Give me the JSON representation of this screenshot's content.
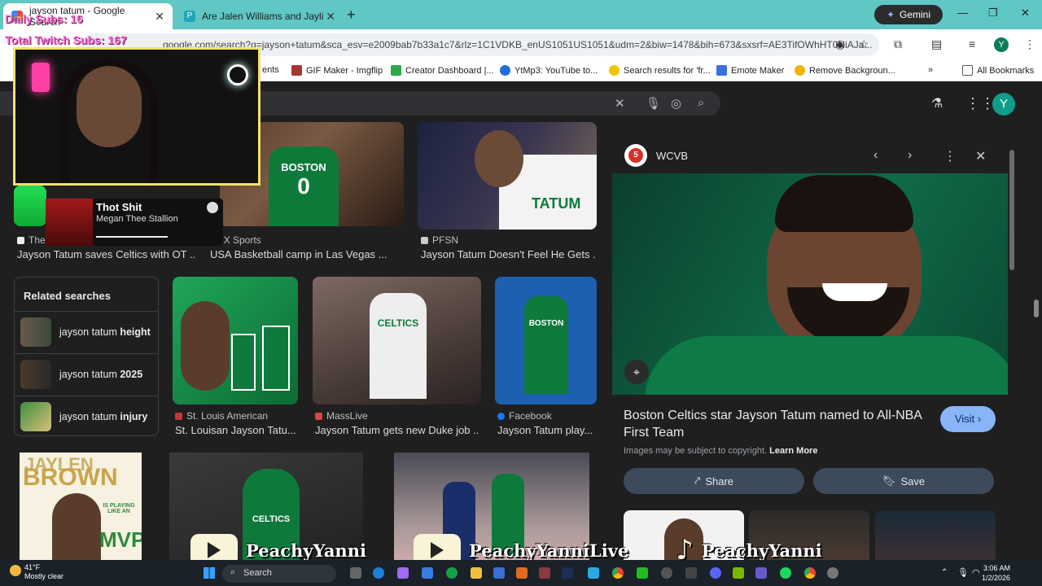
{
  "overlay": {
    "daily_subs": "Daily Subs: 16",
    "total_subs": "Total Twitch Subs: 167",
    "song": "Thot Shit",
    "artist": "Megan Thee Stallion",
    "channels": [
      "PeachyYanni",
      "PeachyYanniLive",
      "PeachyYanni"
    ]
  },
  "tabs": [
    {
      "label": "jayson tatum - Google Search",
      "active": true
    },
    {
      "label": "Are Jalen Williams and Jaylin W",
      "active": false
    }
  ],
  "gemini": "Gemini",
  "address": "google.com/search?q=jayson+tatum&sca_esv=e2009bab7b33a1c7&rlz=1C1VDKB_enUS1051US1051&udm=2&biw=1478&bih=673&sxsrf=AE3TifOWhHT0NiAJa...",
  "bookmarks": [
    "ents",
    "GIF Maker - Imgflip",
    "Creator Dashboard |...",
    "YtMp3: YouTube to...",
    "Search results for 'fr...",
    "Emote Maker",
    "Remove Backgroun...",
    "All Bookmarks"
  ],
  "top_results": [
    {
      "source": "The",
      "caption": "Jayson Tatum saves Celtics with OT ..."
    },
    {
      "source": "FOX Sports",
      "caption": "USA Basketball camp in Las Vegas ..."
    },
    {
      "source": "PFSN",
      "caption": "Jayson Tatum Doesn't Feel He Gets ..."
    }
  ],
  "related": {
    "title": "Related searches",
    "items": [
      {
        "q": "jayson tatum ",
        "b": "height"
      },
      {
        "q": "jayson tatum ",
        "b": "2025"
      },
      {
        "q": "jayson tatum ",
        "b": "injury"
      }
    ]
  },
  "mid_results": [
    {
      "source": "St. Louis American",
      "caption": "St. Louisan Jayson Tatu..."
    },
    {
      "source": "MassLive",
      "caption": "Jayson Tatum gets new Duke job ..."
    },
    {
      "source": "Facebook",
      "caption": "Jayson Tatum play..."
    }
  ],
  "promo": {
    "line1": "JAYLEN",
    "line2": "BROWN",
    "line3": "IS PLAYING LIKE AN",
    "line4": "MVP"
  },
  "panel": {
    "site": "WCVB",
    "title": "Boston Celtics star Jayson Tatum named to All-NBA First Team",
    "visit": "Visit",
    "copyright": "Images may be subject to copyright.",
    "learn_more": "Learn More",
    "share": "Share",
    "save": "Save"
  },
  "jersey": {
    "team": "BOSTON",
    "number": "0",
    "name": "TATUM",
    "celtics": "CELTICS"
  },
  "taskbar": {
    "temp": "41°F",
    "weather": "Mostly clear",
    "search": "Search",
    "time": "3:06 AM",
    "date": "1/2/2026"
  },
  "user_initial": "Y"
}
